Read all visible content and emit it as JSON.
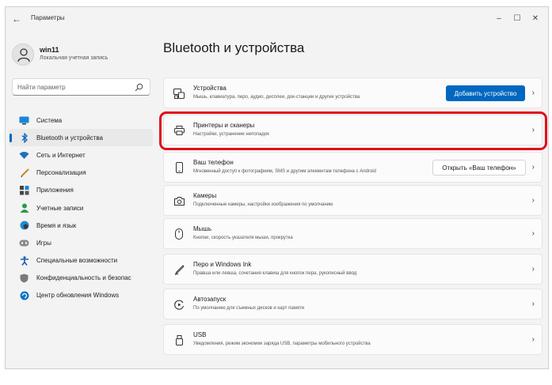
{
  "window": {
    "title": "Параметры",
    "back_icon": "back-arrow-icon",
    "controls": {
      "minimize": "–",
      "maximize": "☐",
      "close": "✕"
    }
  },
  "profile": {
    "name": "win11",
    "subtitle": "Локальная учетная запись"
  },
  "search": {
    "placeholder": "Найти параметр",
    "value": ""
  },
  "nav": {
    "items": [
      {
        "label": "Система",
        "icon": "monitor-icon",
        "active": false
      },
      {
        "label": "Bluetooth и устройства",
        "icon": "bluetooth-icon",
        "active": true
      },
      {
        "label": "Сеть и Интернет",
        "icon": "wifi-icon",
        "active": false
      },
      {
        "label": "Персонализация",
        "icon": "brush-icon",
        "active": false
      },
      {
        "label": "Приложения",
        "icon": "apps-icon",
        "active": false
      },
      {
        "label": "Учетные записи",
        "icon": "person-icon",
        "active": false
      },
      {
        "label": "Время и язык",
        "icon": "globe-clock-icon",
        "active": false
      },
      {
        "label": "Игры",
        "icon": "gamepad-icon",
        "active": false
      },
      {
        "label": "Специальные возможности",
        "icon": "accessibility-icon",
        "active": false
      },
      {
        "label": "Конфиденциальность и безопас",
        "icon": "shield-icon",
        "active": false
      },
      {
        "label": "Центр обновления Windows",
        "icon": "update-icon",
        "active": false
      }
    ]
  },
  "main": {
    "title": "Bluetooth и устройства",
    "cards": [
      {
        "title": "Устройства",
        "desc": "Мышь, клавиатура, перо, аудио, дисплеи, док-станции и другие устройства",
        "icon": "devices-icon",
        "button": "Добавить устройство"
      },
      {
        "title": "Принтеры и сканеры",
        "desc": "Настройки, устранение неполадок",
        "icon": "printer-icon"
      },
      {
        "title": "Ваш телефон",
        "desc": "Мгновенный доступ к фотографиям, SMS и другим элементам телефона с Android",
        "icon": "phone-icon",
        "button": "Открыть «Ваш телефон»"
      },
      {
        "title": "Камеры",
        "desc": "Подключенные камеры, настройки изображения по умолчанию",
        "icon": "camera-icon"
      },
      {
        "title": "Мышь",
        "desc": "Кнопки, скорость указателя мыши, прокрутка",
        "icon": "mouse-icon"
      },
      {
        "title": "Перо и Windows Ink",
        "desc": "Правша или левша, сочетания клавиш для кнопок пера, рукописный ввод",
        "icon": "pen-icon"
      },
      {
        "title": "Автозапуск",
        "desc": "По умолчанию для съемных дисков и карт памяти",
        "icon": "autoplay-icon"
      },
      {
        "title": "USB",
        "desc": "Уведомления, режим экономии заряда USB, параметры мобильного устройства",
        "icon": "usb-icon"
      }
    ],
    "chevron": "›"
  },
  "colors": {
    "accent": "#0067c0",
    "highlight": "#e0101a",
    "background": "#f3f3f3",
    "card": "#fbfbfb"
  }
}
